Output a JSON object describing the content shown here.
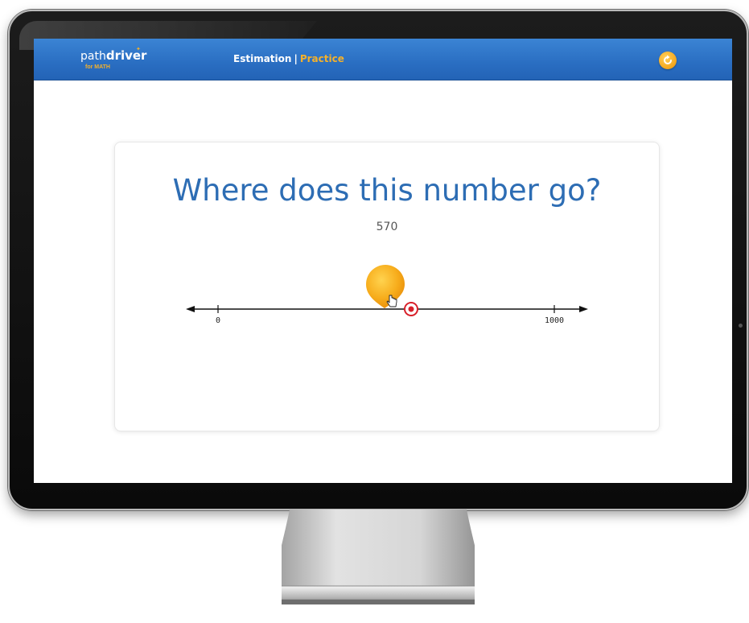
{
  "header": {
    "logo_path": "path",
    "logo_driver": "driver",
    "logo_sub": "for MATH",
    "section": "Estimation",
    "separator": "|",
    "mode": "Practice",
    "refresh_icon": "refresh-icon"
  },
  "question": {
    "prompt": "Where does this number go?",
    "target_value": "570"
  },
  "number_line": {
    "min_label": "0",
    "max_label": "1000",
    "marker_icon": "target-marker-icon",
    "balloon_icon": "balloon-marker-icon",
    "cursor_icon": "hand-cursor-icon"
  },
  "colors": {
    "header_blue": "#2a6ec2",
    "accent_orange": "#f5b12a",
    "question_blue": "#2d6db4",
    "marker_red": "#d8202a"
  }
}
